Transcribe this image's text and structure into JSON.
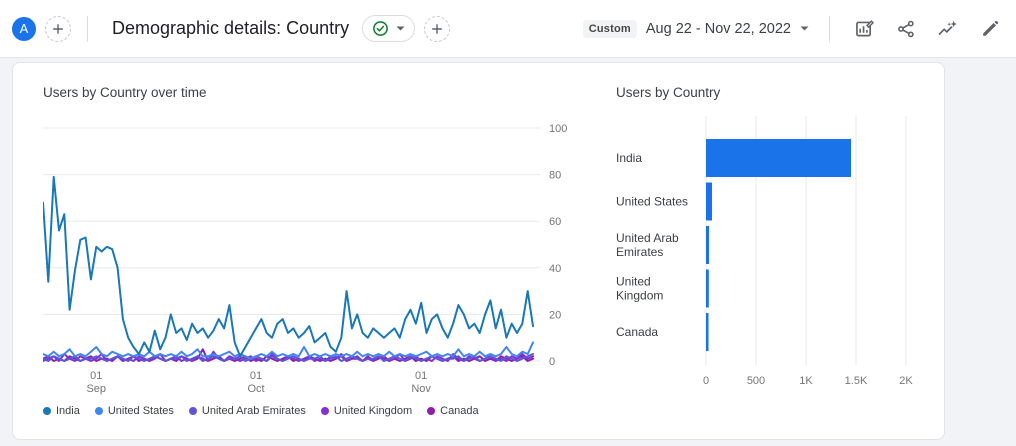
{
  "header": {
    "avatar_label": "A",
    "title": "Demographic details: Country",
    "date_range": {
      "preset": "Custom",
      "label": "Aug 22 - Nov 22, 2022"
    },
    "toolbar_icons": [
      "customize-report-icon",
      "share-icon",
      "insights-icon",
      "edit-icon"
    ]
  },
  "colors": {
    "accent_blue": "#1A73E8",
    "status_green": "#188038",
    "gridline": "#e8eaed",
    "axis_text": "#757575",
    "label_text": "#3c4043",
    "icon_gray": "#5f6368"
  },
  "chart_data": [
    {
      "type": "line",
      "title": "Users by Country over time",
      "ylabel": "",
      "ylim": [
        0,
        100
      ],
      "y_ticks": [
        100,
        80,
        60,
        40,
        20,
        0
      ],
      "y_axis_side": "right",
      "grid": true,
      "legend_position": "bottom",
      "x_ticks": [
        {
          "day": "01",
          "month": "Sep",
          "index": 10
        },
        {
          "day": "01",
          "month": "Oct",
          "index": 40
        },
        {
          "day": "01",
          "month": "Nov",
          "index": 71
        }
      ],
      "series": [
        {
          "name": "India",
          "color": "#1A78B4",
          "values": [
            68,
            34,
            79,
            56,
            63,
            22,
            39,
            52,
            53,
            35,
            49,
            47,
            49,
            48,
            40,
            18,
            10,
            6,
            3,
            8,
            4,
            13,
            5,
            10,
            20,
            12,
            14,
            9,
            16,
            12,
            14,
            10,
            13,
            18,
            14,
            24,
            8,
            2,
            6,
            10,
            14,
            18,
            12,
            10,
            16,
            18,
            12,
            14,
            10,
            12,
            15,
            8,
            10,
            12,
            6,
            4,
            10,
            30,
            14,
            20,
            12,
            10,
            14,
            12,
            10,
            12,
            14,
            10,
            18,
            22,
            16,
            25,
            12,
            18,
            20,
            14,
            10,
            16,
            24,
            20,
            14,
            16,
            12,
            20,
            26,
            14,
            22,
            10,
            16,
            12,
            16,
            30,
            15
          ]
        },
        {
          "name": "United States",
          "color": "#4285F4",
          "values": [
            3,
            2,
            4,
            2,
            3,
            5,
            2,
            3,
            2,
            4,
            6,
            3,
            2,
            4,
            3,
            2,
            3,
            2,
            3,
            2,
            4,
            2,
            3,
            2,
            3,
            2,
            4,
            2,
            3,
            5,
            2,
            2,
            3,
            2,
            3,
            4,
            2,
            3,
            2,
            1,
            2,
            3,
            2,
            4,
            2,
            3,
            2,
            3,
            2,
            6,
            2,
            3,
            2,
            3,
            2,
            3,
            2,
            3,
            2,
            4,
            2,
            3,
            2,
            3,
            2,
            4,
            2,
            3,
            2,
            3,
            2,
            3,
            4,
            2,
            3,
            2,
            3,
            2,
            5,
            2,
            3,
            2,
            4,
            2,
            3,
            2,
            3,
            6,
            3,
            2,
            4,
            3,
            8
          ]
        },
        {
          "name": "United Arab Emirates",
          "color": "#5C56D6",
          "values": [
            1,
            0,
            2,
            1,
            0,
            1,
            2,
            0,
            1,
            1,
            2,
            1,
            0,
            1,
            2,
            1,
            0,
            2,
            1,
            0,
            1,
            2,
            1,
            0,
            1,
            1,
            2,
            0,
            1,
            2,
            0,
            1,
            2,
            1,
            0,
            1,
            1,
            2,
            0,
            1,
            2,
            1,
            0,
            2,
            1,
            0,
            1,
            2,
            1,
            0,
            1,
            1,
            2,
            0,
            1,
            2,
            0,
            1,
            2,
            1,
            0,
            1,
            1,
            2,
            0,
            1,
            2,
            1,
            0,
            2,
            1,
            0,
            1,
            2,
            1,
            0,
            1,
            1,
            2,
            0,
            1,
            2,
            0,
            1,
            2,
            1,
            0,
            2,
            1,
            0,
            1,
            2,
            3
          ]
        },
        {
          "name": "United Kingdom",
          "color": "#8430CE",
          "values": [
            0,
            1,
            2,
            0,
            3,
            1,
            0,
            2,
            1,
            0,
            1,
            3,
            0,
            1,
            2,
            0,
            1,
            0,
            2,
            1,
            0,
            1,
            3,
            0,
            1,
            2,
            0,
            1,
            0,
            2,
            1,
            0,
            4,
            1,
            0,
            2,
            1,
            0,
            1,
            2,
            0,
            1,
            0,
            3,
            1,
            0,
            2,
            1,
            0,
            1,
            2,
            0,
            1,
            0,
            2,
            1,
            3,
            0,
            1,
            2,
            0,
            1,
            0,
            2,
            1,
            0,
            1,
            3,
            0,
            1,
            2,
            0,
            1,
            0,
            2,
            1,
            0,
            3,
            1,
            0,
            2,
            1,
            0,
            1,
            2,
            0,
            1,
            0,
            2,
            1,
            3,
            1,
            2
          ]
        },
        {
          "name": "Canada",
          "color": "#8B1FA9",
          "values": [
            1,
            2,
            0,
            1,
            0,
            2,
            1,
            0,
            1,
            2,
            0,
            1,
            1,
            0,
            2,
            0,
            1,
            2,
            0,
            1,
            0,
            2,
            1,
            0,
            1,
            0,
            2,
            1,
            0,
            1,
            5,
            0,
            1,
            2,
            0,
            1,
            0,
            1,
            2,
            0,
            1,
            0,
            2,
            1,
            0,
            1,
            2,
            0,
            1,
            0,
            2,
            1,
            0,
            1,
            0,
            1,
            2,
            0,
            1,
            1,
            0,
            2,
            0,
            1,
            2,
            0,
            1,
            0,
            1,
            2,
            0,
            1,
            0,
            2,
            1,
            0,
            1,
            2,
            0,
            1,
            0,
            1,
            2,
            0,
            1,
            0,
            2,
            1,
            0,
            1,
            2,
            0,
            1
          ]
        }
      ]
    },
    {
      "type": "bar",
      "orientation": "horizontal",
      "title": "Users by Country",
      "categories": [
        "India",
        "United States",
        "United Arab Emirates",
        "United Kingdom",
        "Canada"
      ],
      "values": [
        1450,
        60,
        30,
        28,
        25
      ],
      "bar_color": "#1A73E8",
      "xlim": [
        0,
        2000
      ],
      "x_ticks": [
        "0",
        "500",
        "1K",
        "1.5K",
        "2K"
      ],
      "x_tick_values": [
        0,
        500,
        1000,
        1500,
        2000
      ],
      "grid": true
    }
  ]
}
